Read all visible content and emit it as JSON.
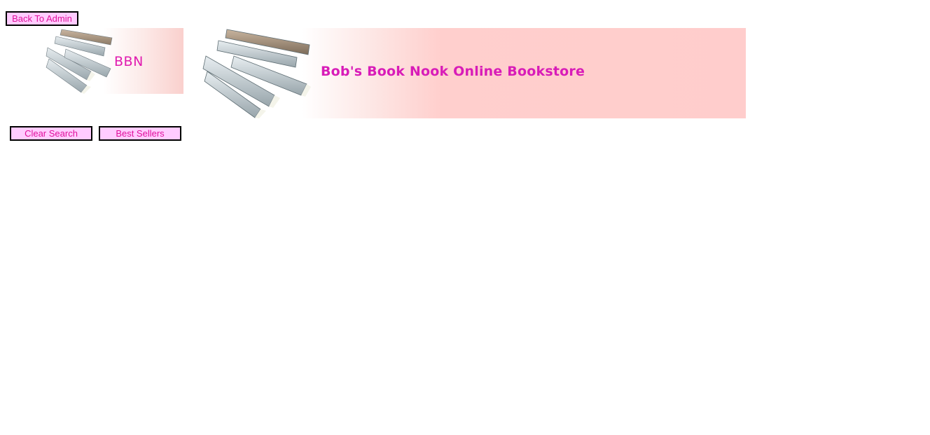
{
  "toolbar": {
    "back_to_admin_label": "Back To Admin",
    "clear_search_label": "Clear Search",
    "best_sellers_label": "Best Sellers"
  },
  "logo": {
    "small_text": "BBN",
    "banner_title": "Bob's Book Nook Online Bookstore",
    "icon": "books-stack-icon"
  },
  "colors": {
    "button_bg": "#ffccff",
    "button_text": "#e0119b",
    "button_border": "#000000",
    "logo_text": "#d81cb8",
    "banner_bg": "#ffcdcc"
  }
}
